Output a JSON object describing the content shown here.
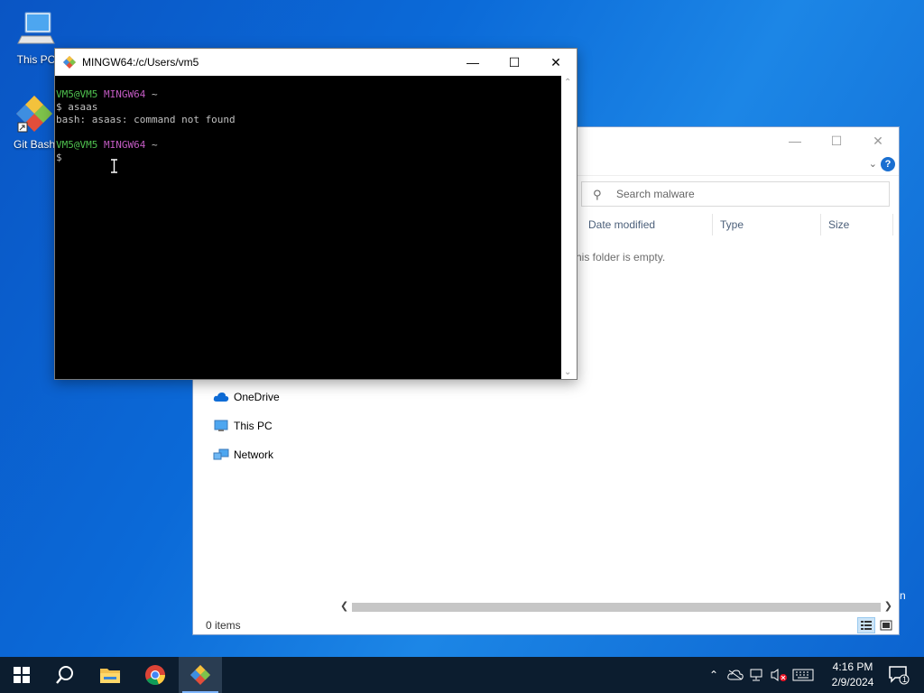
{
  "desktop": {
    "icons": [
      {
        "label": "This PC",
        "icon": "computer-icon"
      },
      {
        "label": "Git Bash",
        "icon": "git-bash-icon"
      }
    ]
  },
  "explorer": {
    "search_placeholder": "Search malware",
    "columns": [
      "Date modified",
      "Type",
      "Size"
    ],
    "empty_message": "his folder is empty.",
    "nav": [
      {
        "label": "OneDrive",
        "icon": "cloud-icon"
      },
      {
        "label": "This PC",
        "icon": "computer-icon"
      },
      {
        "label": "Network",
        "icon": "network-icon"
      }
    ],
    "status": "0 items",
    "help_glyph": "?",
    "edge_char": "n"
  },
  "terminal": {
    "title": "MINGW64:/c/Users/vm5",
    "prompt_user": "VM5@VM5",
    "prompt_env": "MINGW64",
    "prompt_dir": "~",
    "lines": [
      {
        "kind": "prompt"
      },
      {
        "kind": "text",
        "text": "$ asaas"
      },
      {
        "kind": "text",
        "text": "bash: asaas: command not found"
      },
      {
        "kind": "blank"
      },
      {
        "kind": "prompt"
      },
      {
        "kind": "text",
        "text": "$"
      }
    ]
  },
  "taskbar": {
    "buttons": [
      "start-button",
      "search-button",
      "file-explorer-button",
      "chrome-button",
      "git-bash-button"
    ],
    "clock_time": "4:16 PM",
    "clock_date": "2/9/2024",
    "notification_count": "1"
  },
  "colors": {
    "prompt_user": "#4fc24f",
    "prompt_env": "#c35bc3",
    "taskbar": "#0c1d2f",
    "accent": "#1a6fd1"
  }
}
